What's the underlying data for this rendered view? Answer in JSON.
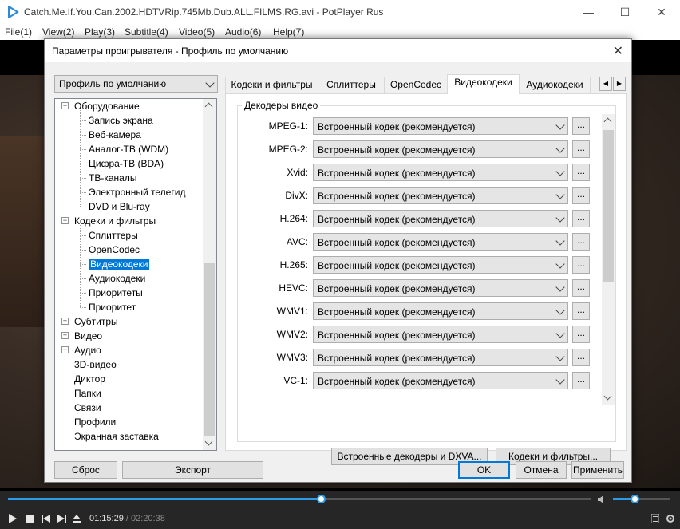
{
  "window": {
    "title": "Catch.Me.If.You.Can.2002.HDTVRip.745Mb.Dub.ALL.FILMS.RG.avi - PotPlayer Rus",
    "minimize": "—",
    "maximize": "☐",
    "close": "✕"
  },
  "menu": [
    "File(1)",
    "View(2)",
    "Play(3)",
    "Subtitle(4)",
    "Video(5)",
    "Audio(6)",
    "Help(7)"
  ],
  "dialog": {
    "title": "Параметры проигрывателя - Профиль по умолчанию",
    "close": "✕",
    "profile": "Профиль по умолчанию",
    "tree": [
      {
        "label": "Оборудование",
        "level": 0,
        "expander": "−"
      },
      {
        "label": "Запись экрана",
        "level": 1
      },
      {
        "label": "Веб-камера",
        "level": 1
      },
      {
        "label": "Аналог-ТВ (WDM)",
        "level": 1
      },
      {
        "label": "Цифра-ТВ (BDA)",
        "level": 1
      },
      {
        "label": "ТВ-каналы",
        "level": 1
      },
      {
        "label": "Электронный телегид",
        "level": 1
      },
      {
        "label": "DVD и Blu-ray",
        "level": 1
      },
      {
        "label": "Кодеки и фильтры",
        "level": 0,
        "expander": "−"
      },
      {
        "label": "Сплиттеры",
        "level": 1
      },
      {
        "label": "OpenCodec",
        "level": 1
      },
      {
        "label": "Видеокодеки",
        "level": 1,
        "selected": true
      },
      {
        "label": "Аудиокодеки",
        "level": 1
      },
      {
        "label": "Приоритеты",
        "level": 1
      },
      {
        "label": "Приоритет",
        "level": 1
      },
      {
        "label": "Субтитры",
        "level": 0,
        "expander": "+"
      },
      {
        "label": "Видео",
        "level": 0,
        "expander": "+"
      },
      {
        "label": "Аудио",
        "level": 0,
        "expander": "+"
      },
      {
        "label": "3D-видео",
        "level": 0
      },
      {
        "label": "Диктор",
        "level": 0
      },
      {
        "label": "Папки",
        "level": 0
      },
      {
        "label": "Связи",
        "level": 0
      },
      {
        "label": "Профили",
        "level": 0
      },
      {
        "label": "Экранная заставка",
        "level": 0
      }
    ],
    "tabs": [
      "Кодеки и фильтры",
      "Сплиттеры",
      "OpenCodec",
      "Видеокодеки",
      "Аудиокодеки"
    ],
    "active_tab": "Видеокодеки",
    "tab_prev": "◀",
    "tab_next": "▶",
    "group_title": "Декодеры видео",
    "decoders": [
      {
        "label": "MPEG-1:",
        "value": "Встроенный кодек (рекомендуется)"
      },
      {
        "label": "MPEG-2:",
        "value": "Встроенный кодек (рекомендуется)"
      },
      {
        "label": "Xvid:",
        "value": "Встроенный кодек (рекомендуется)"
      },
      {
        "label": "DivX:",
        "value": "Встроенный кодек (рекомендуется)"
      },
      {
        "label": "H.264:",
        "value": "Встроенный кодек (рекомендуется)"
      },
      {
        "label": "AVC:",
        "value": "Встроенный кодек (рекомендуется)"
      },
      {
        "label": "H.265:",
        "value": "Встроенный кодек (рекомендуется)"
      },
      {
        "label": "HEVC:",
        "value": "Встроенный кодек (рекомендуется)"
      },
      {
        "label": "WMV1:",
        "value": "Встроенный кодек (рекомендуется)"
      },
      {
        "label": "WMV2:",
        "value": "Встроенный кодек (рекомендуется)"
      },
      {
        "label": "WMV3:",
        "value": "Встроенный кодек (рекомендуется)"
      },
      {
        "label": "VC-1:",
        "value": "Встроенный кодек (рекомендуется)"
      }
    ],
    "dots_label": "...",
    "builtin_button": "Встроенные декодеры и DXVA...",
    "codecs_button": "Кодеки и фильтры...",
    "reset_button": "Сброс",
    "export_button": "Экспорт",
    "ok_button": "OK",
    "cancel_button": "Отмена",
    "apply_button": "Применить"
  },
  "player": {
    "position": "01:15:29",
    "separator": " / ",
    "duration": "02:20:38",
    "progress": 0.537,
    "volume": 0.38,
    "accent": "#2c9be8"
  }
}
